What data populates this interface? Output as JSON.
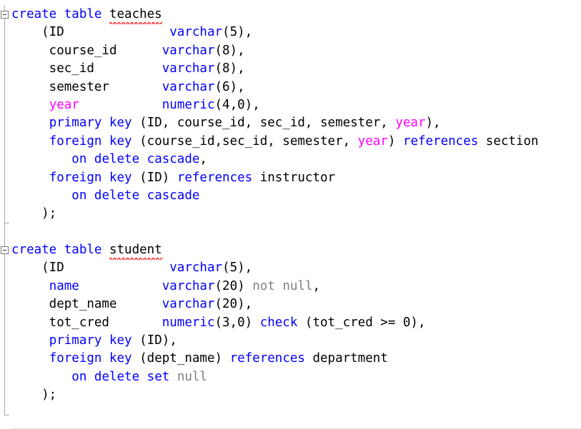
{
  "editor": {
    "name": "sql-code-editor",
    "background_color": "#ffffff",
    "font_size_px": 17.5,
    "line_height_px": 25.4,
    "colors": {
      "keyword": "#0000ff",
      "highlight_identifier": "#ff00ff",
      "plain": "#000000",
      "muted": "#808080",
      "error_squiggle": "#ff0000",
      "gutter_line": "#a6a6a6"
    }
  },
  "gutter": {
    "fold_markers": [
      {
        "label": "collapse-create-table-teaches",
        "state": "expanded",
        "glyph": "minus"
      },
      {
        "label": "collapse-create-table-student",
        "state": "expanded",
        "glyph": "minus"
      }
    ]
  },
  "code": {
    "lines": [
      {
        "id": "line-1",
        "tokens": [
          {
            "t": "create table ",
            "c": "kw"
          },
          {
            "t": "teaches",
            "c": "pln",
            "squiggle": true
          }
        ]
      },
      {
        "id": "line-2",
        "tokens": [
          {
            "t": "    (ID              ",
            "c": "pln"
          },
          {
            "t": "varchar",
            "c": "kw"
          },
          {
            "t": "(5),",
            "c": "pln"
          }
        ]
      },
      {
        "id": "line-3",
        "tokens": [
          {
            "t": "     course_id      ",
            "c": "pln"
          },
          {
            "t": "varchar",
            "c": "kw"
          },
          {
            "t": "(8),",
            "c": "pln"
          }
        ]
      },
      {
        "id": "line-4",
        "tokens": [
          {
            "t": "     sec_id         ",
            "c": "pln"
          },
          {
            "t": "varchar",
            "c": "kw"
          },
          {
            "t": "(8),",
            "c": "pln"
          }
        ]
      },
      {
        "id": "line-5",
        "tokens": [
          {
            "t": "     semester       ",
            "c": "pln"
          },
          {
            "t": "varchar",
            "c": "kw"
          },
          {
            "t": "(6),",
            "c": "pln"
          }
        ]
      },
      {
        "id": "line-6",
        "tokens": [
          {
            "t": "     ",
            "c": "pln"
          },
          {
            "t": "year",
            "c": "mag"
          },
          {
            "t": "           ",
            "c": "pln"
          },
          {
            "t": "numeric",
            "c": "kw"
          },
          {
            "t": "(4,0),",
            "c": "pln"
          }
        ]
      },
      {
        "id": "line-7",
        "tokens": [
          {
            "t": "     ",
            "c": "pln"
          },
          {
            "t": "primary key",
            "c": "kw"
          },
          {
            "t": " (ID, course_id, sec_id, semester, ",
            "c": "pln"
          },
          {
            "t": "year",
            "c": "mag"
          },
          {
            "t": "),",
            "c": "pln"
          }
        ]
      },
      {
        "id": "line-8",
        "tokens": [
          {
            "t": "     ",
            "c": "pln"
          },
          {
            "t": "foreign key",
            "c": "kw"
          },
          {
            "t": " (course_id,sec_id, semester, ",
            "c": "pln"
          },
          {
            "t": "year",
            "c": "mag"
          },
          {
            "t": ") ",
            "c": "pln"
          },
          {
            "t": "references",
            "c": "kw"
          },
          {
            "t": " section",
            "c": "pln"
          }
        ]
      },
      {
        "id": "line-9",
        "tokens": [
          {
            "t": "        ",
            "c": "pln"
          },
          {
            "t": "on delete cascade",
            "c": "kw"
          },
          {
            "t": ",",
            "c": "pln"
          }
        ]
      },
      {
        "id": "line-10",
        "tokens": [
          {
            "t": "     ",
            "c": "pln"
          },
          {
            "t": "foreign key",
            "c": "kw"
          },
          {
            "t": " (ID) ",
            "c": "pln"
          },
          {
            "t": "references",
            "c": "kw"
          },
          {
            "t": " instructor",
            "c": "pln"
          }
        ]
      },
      {
        "id": "line-11",
        "tokens": [
          {
            "t": "        ",
            "c": "pln"
          },
          {
            "t": "on delete cascade",
            "c": "kw"
          }
        ]
      },
      {
        "id": "line-12",
        "tokens": [
          {
            "t": "    );",
            "c": "pln"
          }
        ]
      },
      {
        "id": "line-13",
        "tokens": [
          {
            "t": " ",
            "c": "pln"
          }
        ]
      },
      {
        "id": "line-14",
        "tokens": [
          {
            "t": "create table ",
            "c": "kw"
          },
          {
            "t": "student",
            "c": "pln",
            "squiggle": true
          }
        ]
      },
      {
        "id": "line-15",
        "tokens": [
          {
            "t": "    (ID              ",
            "c": "pln"
          },
          {
            "t": "varchar",
            "c": "kw"
          },
          {
            "t": "(5),",
            "c": "pln"
          }
        ]
      },
      {
        "id": "line-16",
        "tokens": [
          {
            "t": "     ",
            "c": "pln"
          },
          {
            "t": "name",
            "c": "kw"
          },
          {
            "t": "           ",
            "c": "pln"
          },
          {
            "t": "varchar",
            "c": "kw"
          },
          {
            "t": "(20) ",
            "c": "pln"
          },
          {
            "t": "not null",
            "c": "gry"
          },
          {
            "t": ",",
            "c": "pln"
          }
        ]
      },
      {
        "id": "line-17",
        "tokens": [
          {
            "t": "     dept_name      ",
            "c": "pln"
          },
          {
            "t": "varchar",
            "c": "kw"
          },
          {
            "t": "(20),",
            "c": "pln"
          }
        ]
      },
      {
        "id": "line-18",
        "tokens": [
          {
            "t": "     tot_cred       ",
            "c": "pln"
          },
          {
            "t": "numeric",
            "c": "kw"
          },
          {
            "t": "(3,0) ",
            "c": "pln"
          },
          {
            "t": "check",
            "c": "kw"
          },
          {
            "t": " (tot_cred >= 0),",
            "c": "pln"
          }
        ]
      },
      {
        "id": "line-19",
        "tokens": [
          {
            "t": "     ",
            "c": "pln"
          },
          {
            "t": "primary key",
            "c": "kw"
          },
          {
            "t": " (ID),",
            "c": "pln"
          }
        ]
      },
      {
        "id": "line-20",
        "tokens": [
          {
            "t": "     ",
            "c": "pln"
          },
          {
            "t": "foreign key",
            "c": "kw"
          },
          {
            "t": " (dept_name) ",
            "c": "pln"
          },
          {
            "t": "references",
            "c": "kw"
          },
          {
            "t": " department",
            "c": "pln"
          }
        ]
      },
      {
        "id": "line-21",
        "tokens": [
          {
            "t": "        ",
            "c": "pln"
          },
          {
            "t": "on delete set",
            "c": "kw"
          },
          {
            "t": " ",
            "c": "pln"
          },
          {
            "t": "null",
            "c": "gry"
          }
        ]
      },
      {
        "id": "line-22",
        "tokens": [
          {
            "t": "    );",
            "c": "pln"
          }
        ]
      }
    ]
  }
}
